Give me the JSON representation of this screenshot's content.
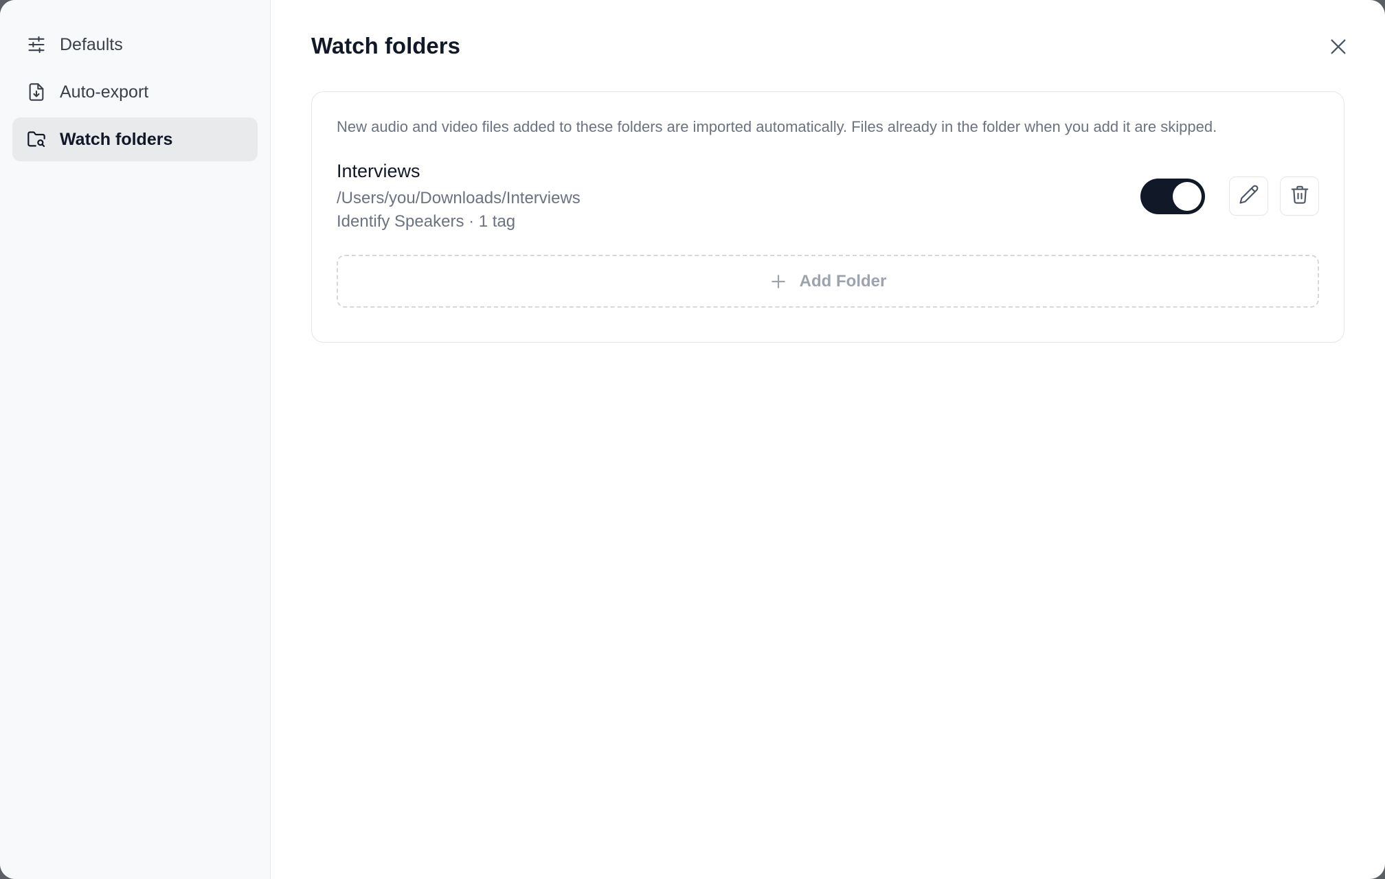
{
  "sidebar": {
    "items": [
      {
        "label": "Defaults",
        "icon": "sliders-icon",
        "active": false
      },
      {
        "label": "Auto-export",
        "icon": "file-download-icon",
        "active": false
      },
      {
        "label": "Watch folders",
        "icon": "folder-search-icon",
        "active": true
      }
    ]
  },
  "main": {
    "title": "Watch folders",
    "close_icon": "close-icon",
    "description": "New audio and video files added to these folders are imported automatically. Files already in the folder when you add it are skipped.",
    "folders": [
      {
        "name": "Interviews",
        "path": "/Users/you/Downloads/Interviews",
        "meta": "Identify Speakers · 1 tag",
        "enabled": true
      }
    ],
    "add_folder_label": "Add Folder"
  },
  "colors": {
    "accent": "#111827",
    "sidebar_bg": "#f8f9fb",
    "active_item_bg": "#e9eaec",
    "muted_text": "#6b7280"
  }
}
